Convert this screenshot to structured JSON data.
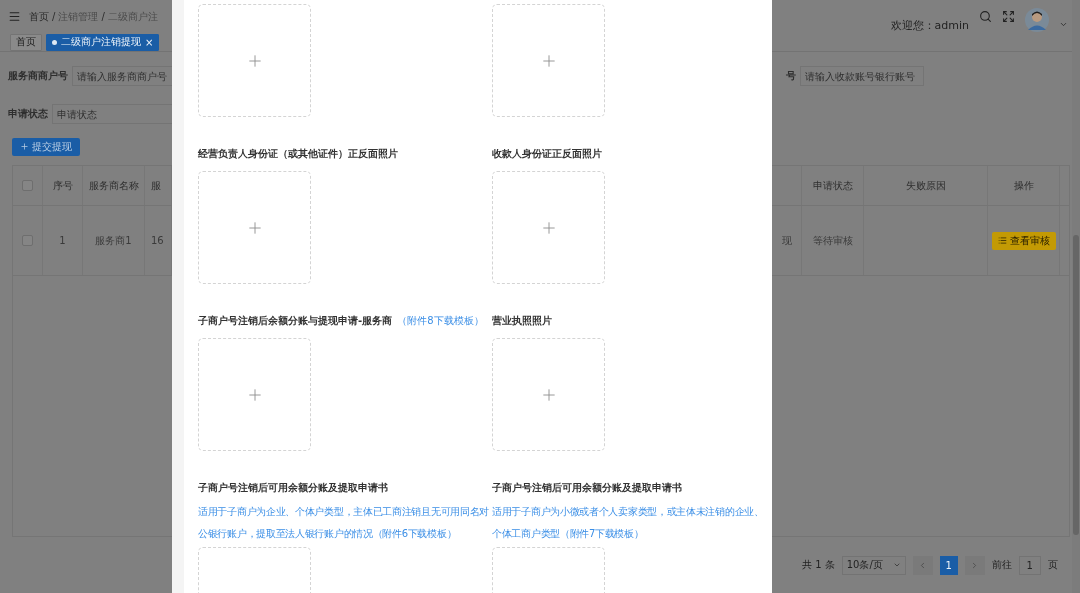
{
  "header": {
    "breadcrumb": [
      {
        "label": "首页"
      },
      {
        "separator": "/",
        "label": "注销管理"
      },
      {
        "separator": "/",
        "label": "二级商户注"
      }
    ],
    "welcome": "欢迎您：admin"
  },
  "tags": [
    {
      "label": "首页",
      "selected": false
    },
    {
      "label": "二级商户注销提现",
      "selected": true,
      "close": "×"
    }
  ],
  "filters_left": [
    {
      "label": "服务商商户号",
      "placeholder": "请输入服务商商户号"
    },
    {
      "label": "申请状态",
      "placeholder": "申请状态"
    }
  ],
  "filter_right": {
    "label": "号",
    "placeholder": "请输入收款账号银行账号"
  },
  "submit_button": "提交提现",
  "table_left": {
    "columns": [
      "序号",
      "服务商名称",
      "服"
    ],
    "rows": [
      {
        "checked": false,
        "cells": [
          "1",
          "服务商1",
          "16"
        ]
      }
    ]
  },
  "table_right": {
    "columns": [
      "申请状态",
      "失败原因",
      "操作"
    ],
    "rows": [
      {
        "column_0": "现",
        "status": "等待审核",
        "action": "查看审核"
      }
    ]
  },
  "pagination": {
    "total": "共 1 条",
    "page_size": "10条/页",
    "pages": [
      {
        "label": "1",
        "selected": true
      }
    ],
    "goto_label": "前往",
    "goto_value": "1",
    "goto_suffix": "页"
  },
  "dialog": {
    "items": [
      {
        "kind": "bare"
      },
      {
        "kind": "bare"
      },
      {
        "kind": "labeled",
        "label": "经营负责人身份证（或其他证件）正反面照片"
      },
      {
        "kind": "labeled",
        "label": "收款人身份证正反面照片"
      },
      {
        "kind": "labeled",
        "label": "子商户号注销后余额分账与提现申请-服务商",
        "link": "（附件8下载模板）"
      },
      {
        "kind": "labeled",
        "label": "营业执照照片"
      },
      {
        "kind": "labeled",
        "label": "子商户号注销后可用余额分账及提取申请书",
        "note": "适用于子商户为企业、个体户类型，主体已工商注销且无可用同名对公银行账户，提取至法人银行账户的情况（附件6下载模板）"
      },
      {
        "kind": "labeled",
        "label": "子商户号注销后可用余额分账及提取申请书",
        "note": "适用于子商户为小微或者个人卖家类型，或主体未注销的企业、个体工商户类型（附件7下载模板）"
      }
    ]
  }
}
